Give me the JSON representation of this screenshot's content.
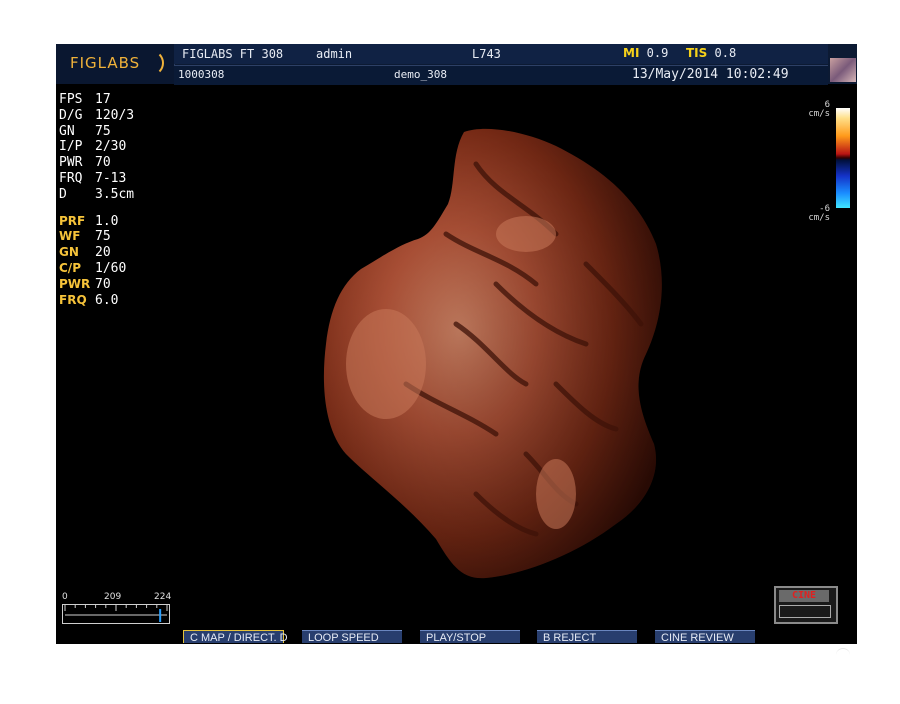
{
  "header": {
    "logo": "FIGLABS",
    "system": "FIGLABS FT 308",
    "user": "admin",
    "probe": "L743",
    "mi_label": "MI",
    "mi_value": "0.9",
    "tis_label": "TIS",
    "tis_value": "0.8",
    "patient_id": "1000308",
    "patient_name": "demo_308",
    "datetime": "13/May/2014 10:02:49"
  },
  "params_b": [
    {
      "k": "FPS",
      "v": "17"
    },
    {
      "k": "D/G",
      "v": "120/3"
    },
    {
      "k": "GN",
      "v": "75"
    },
    {
      "k": "I/P",
      "v": "2/30"
    },
    {
      "k": "PWR",
      "v": "70"
    },
    {
      "k": "FRQ",
      "v": "7-13"
    },
    {
      "k": "D",
      "v": "3.5cm"
    }
  ],
  "params_c": [
    {
      "k": "PRF",
      "v": "1.0"
    },
    {
      "k": "WF",
      "v": "75"
    },
    {
      "k": "GN",
      "v": "20"
    },
    {
      "k": "C/P",
      "v": "1/60"
    },
    {
      "k": "PWR",
      "v": "70"
    },
    {
      "k": "FRQ",
      "v": "6.0"
    }
  ],
  "colorbar": {
    "top_value": "6",
    "top_unit": "cm/s",
    "bottom_value": "-6",
    "bottom_unit": "cm/s"
  },
  "cine_scale": {
    "min": "0",
    "current": "209",
    "max": "224",
    "position": 0.933
  },
  "cine_indicator": "CINE",
  "softkeys": [
    "C MAP / DIRECT. D",
    "LOOP SPEED",
    "PLAY/STOP",
    "B REJECT",
    "CINE REVIEW"
  ],
  "colors": {
    "header_bg": "#0c1a33",
    "accent_yellow": "#f6c33a",
    "render_tone": "#9a3a1c",
    "softkey_bg": "#283e6e"
  }
}
